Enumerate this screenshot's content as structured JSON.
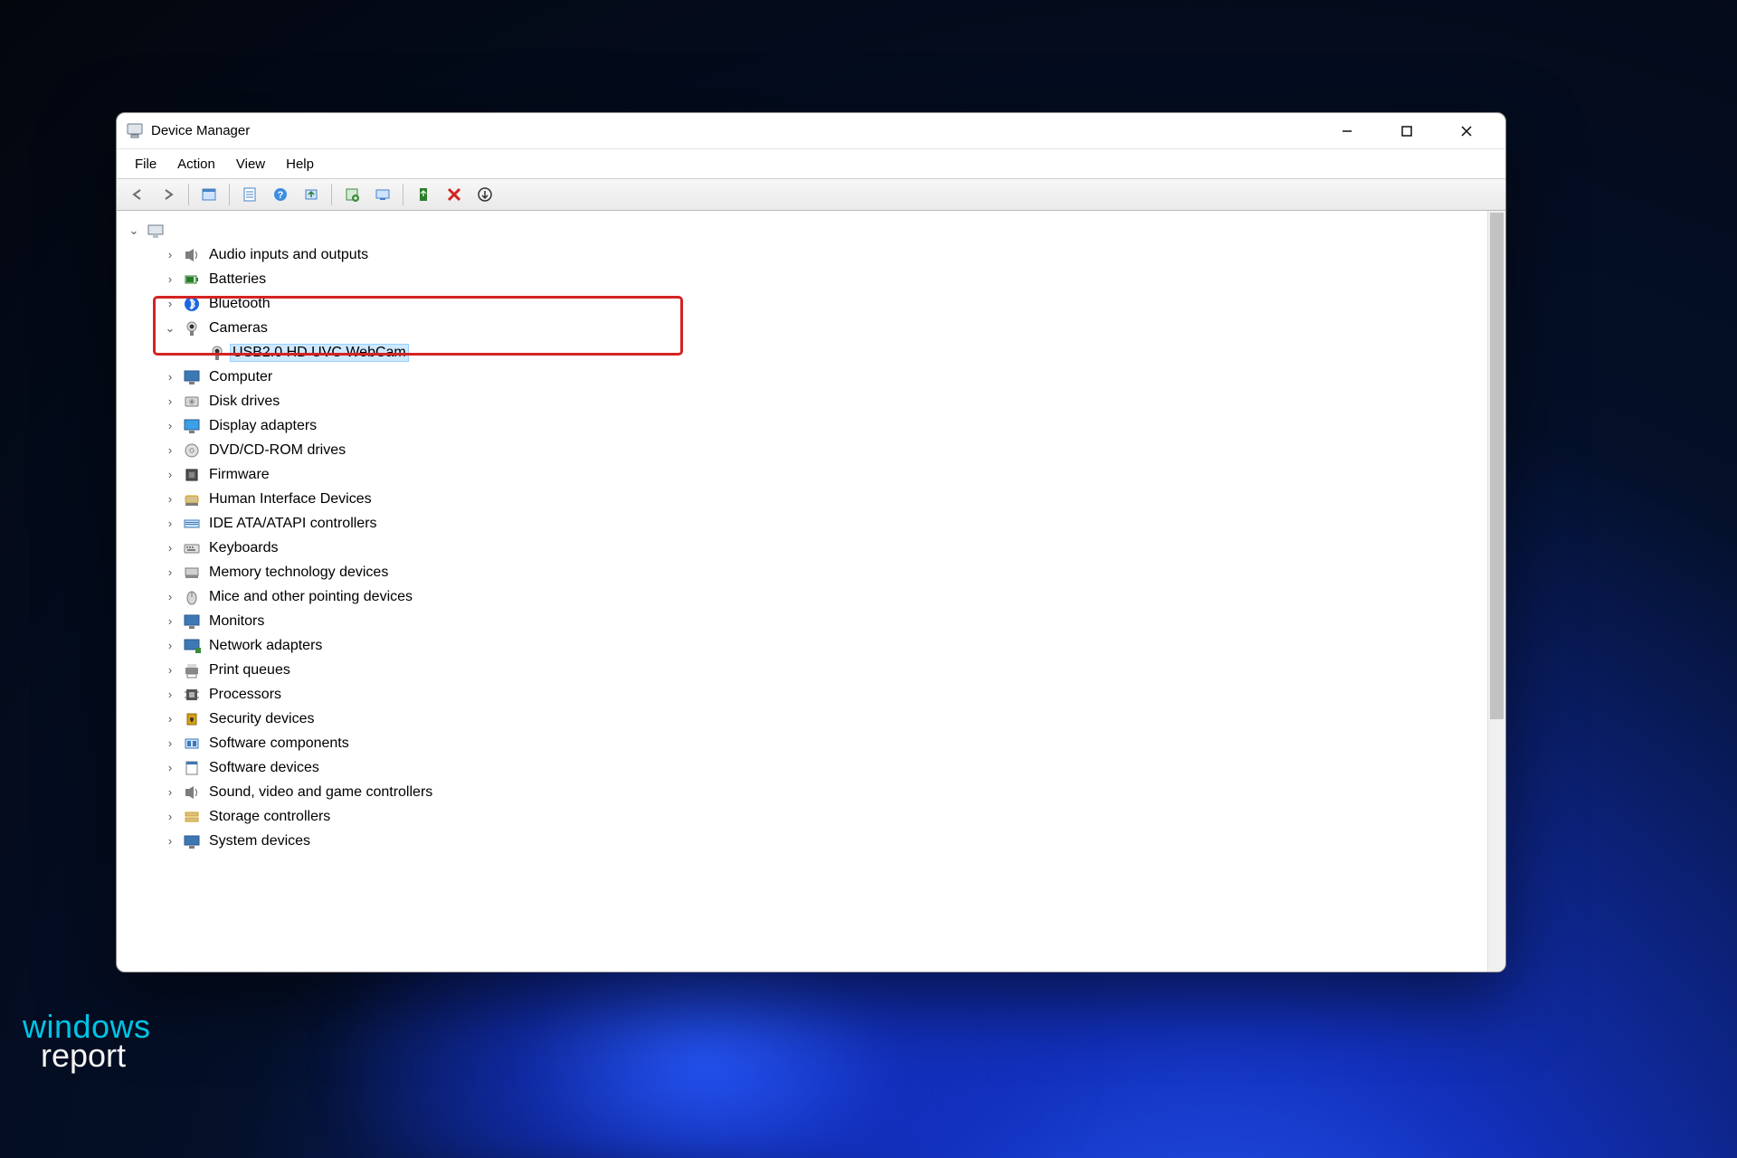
{
  "window": {
    "title": "Device Manager"
  },
  "menu": {
    "file": "File",
    "action": "Action",
    "view": "View",
    "help": "Help"
  },
  "toolbar_icons": [
    "back",
    "forward",
    "show-hidden",
    "properties",
    "help",
    "update-driver",
    "uninstall",
    "scan-hardware",
    "add-legacy",
    "disable",
    "remove",
    "details"
  ],
  "tree": {
    "root_icon": "computer-icon",
    "categories": [
      {
        "icon": "speaker-icon",
        "label": "Audio inputs and outputs",
        "expanded": false
      },
      {
        "icon": "battery-icon",
        "label": "Batteries",
        "expanded": false
      },
      {
        "icon": "bluetooth-icon",
        "label": "Bluetooth",
        "expanded": false
      },
      {
        "icon": "camera-icon",
        "label": "Cameras",
        "expanded": true,
        "children": [
          {
            "icon": "webcam-icon",
            "label": "USB2.0 HD UVC WebCam",
            "selected": true
          }
        ]
      },
      {
        "icon": "monitor-icon",
        "label": "Computer",
        "expanded": false
      },
      {
        "icon": "disk-icon",
        "label": "Disk drives",
        "expanded": false
      },
      {
        "icon": "display-icon",
        "label": "Display adapters",
        "expanded": false
      },
      {
        "icon": "optical-icon",
        "label": "DVD/CD-ROM drives",
        "expanded": false
      },
      {
        "icon": "chip-icon",
        "label": "Firmware",
        "expanded": false
      },
      {
        "icon": "hid-icon",
        "label": "Human Interface Devices",
        "expanded": false
      },
      {
        "icon": "ide-icon",
        "label": "IDE ATA/ATAPI controllers",
        "expanded": false
      },
      {
        "icon": "keyboard-icon",
        "label": "Keyboards",
        "expanded": false
      },
      {
        "icon": "memory-icon",
        "label": "Memory technology devices",
        "expanded": false
      },
      {
        "icon": "mouse-icon",
        "label": "Mice and other pointing devices",
        "expanded": false
      },
      {
        "icon": "monitor2-icon",
        "label": "Monitors",
        "expanded": false
      },
      {
        "icon": "network-icon",
        "label": "Network adapters",
        "expanded": false
      },
      {
        "icon": "printer-icon",
        "label": "Print queues",
        "expanded": false
      },
      {
        "icon": "cpu-icon",
        "label": "Processors",
        "expanded": false
      },
      {
        "icon": "security-icon",
        "label": "Security devices",
        "expanded": false
      },
      {
        "icon": "component-icon",
        "label": "Software components",
        "expanded": false
      },
      {
        "icon": "software-icon",
        "label": "Software devices",
        "expanded": false
      },
      {
        "icon": "sound-icon",
        "label": "Sound, video and game controllers",
        "expanded": false
      },
      {
        "icon": "storage-icon",
        "label": "Storage controllers",
        "expanded": false
      },
      {
        "icon": "system-icon",
        "label": "System devices",
        "expanded": false
      }
    ]
  },
  "watermark": {
    "line1": "windows",
    "line2": "report"
  }
}
